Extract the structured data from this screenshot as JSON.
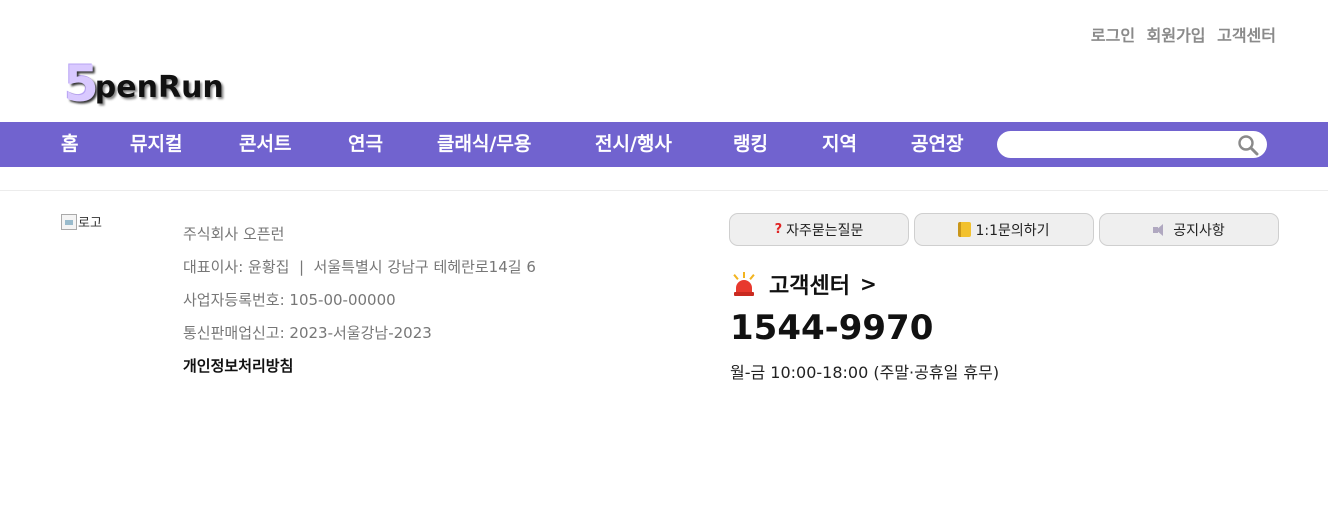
{
  "header": {
    "links": [
      "로그인",
      "회원가입",
      "고객센터"
    ],
    "logo": {
      "first": "5",
      "rest": "penRun"
    }
  },
  "nav": {
    "items": [
      "홈",
      "뮤지컬",
      "콘서트",
      "연극",
      "클래식/무용",
      "전시/행사",
      "랭킹",
      "지역",
      "공연장"
    ],
    "search": {
      "value": "",
      "placeholder": ""
    },
    "background": "#7163cf"
  },
  "footer": {
    "logo_alt": "로고",
    "company_name": "주식회사 오픈런",
    "representative": "대표이사: 윤황집  |  서울특별시 강남구 테헤란로14길 6",
    "business_no": "사업자등록번호: 105-00-00000",
    "mail_order": "통신판매업신고: 2023-서울강남-2023",
    "privacy_policy": "개인정보처리방침"
  },
  "customer_service": {
    "buttons": {
      "faq": "자주묻는질문",
      "inquiry": "1:1문의하기",
      "notice": "공지사항"
    },
    "title": "고객센터",
    "arrow": ">",
    "phone": "1544-9970",
    "hours": "월-금 10:00-18:00 (주말·공휴일 휴무)"
  }
}
